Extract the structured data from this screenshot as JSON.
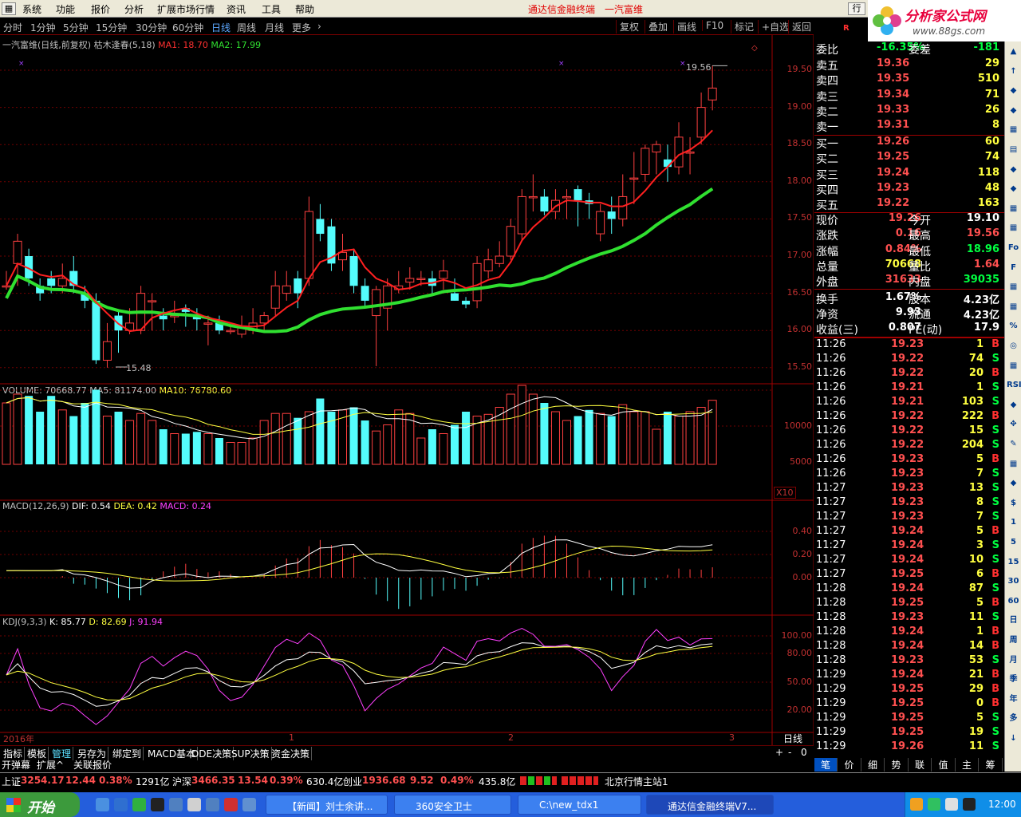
{
  "menu": {
    "items": [
      "系统",
      "功能",
      "报价",
      "分析",
      "扩展市场行情",
      "资讯",
      "工具",
      "帮助"
    ],
    "title1": "通达信金融终端",
    "title2": "一汽富维",
    "hang": "行"
  },
  "logo": {
    "text": "分析家公式网",
    "url": "www.88gs.com"
  },
  "periods": {
    "items": [
      "分时",
      "1分钟",
      "5分钟",
      "15分钟",
      "30分钟",
      "60分钟",
      "日线",
      "周线",
      "月线",
      "更多"
    ],
    "active": "日线",
    "right": [
      "复权",
      "叠加",
      "画线",
      "F10",
      "标记",
      "+自选",
      "返回"
    ]
  },
  "main": {
    "title": "一汽富维(日线,前复权) 枯木逢春(5,18)",
    "ma1": "MA1: 18.70",
    "ma2": "MA2: 17.99",
    "hi_label": "19.56",
    "lo_label": "15.48",
    "axis": [
      "19.50",
      "19.00",
      "18.50",
      "18.00",
      "17.50",
      "17.00",
      "16.50",
      "16.00",
      "15.50"
    ]
  },
  "volume": {
    "label": "VOLUME: 70668.77",
    "ma5": "MA5: 81174.00",
    "ma10": "MA10: 76780.60",
    "axis": [
      "10000",
      "5000"
    ],
    "unit": "X10"
  },
  "macd": {
    "label": "MACD(12,26,9)",
    "dif": "DIF: 0.54",
    "dea": "DEA: 0.42",
    "macd": "MACD: 0.24",
    "axis": [
      "0.40",
      "0.20",
      "0.00"
    ]
  },
  "kdj": {
    "label": "KDJ(9,3,3)",
    "k": "K: 85.77",
    "d": "D: 82.69",
    "j": "J: 91.94",
    "axis": [
      "100.00",
      "80.00",
      "50.00",
      "20.00"
    ]
  },
  "dates": {
    "year": "2016年",
    "m1": "1",
    "m2": "2",
    "m3": "3",
    "period": "日线"
  },
  "quote": {
    "wb_label": "委比",
    "wb_val": "-16.35%",
    "wc_label": "委差",
    "wc_val": "-181",
    "sells": [
      {
        "l": "卖五",
        "p": "19.36",
        "v": "29"
      },
      {
        "l": "卖四",
        "p": "19.35",
        "v": "510"
      },
      {
        "l": "卖三",
        "p": "19.34",
        "v": "71"
      },
      {
        "l": "卖二",
        "p": "19.33",
        "v": "26"
      },
      {
        "l": "卖一",
        "p": "19.31",
        "v": "8"
      }
    ],
    "buys": [
      {
        "l": "买一",
        "p": "19.26",
        "v": "60"
      },
      {
        "l": "买二",
        "p": "19.25",
        "v": "74"
      },
      {
        "l": "买三",
        "p": "19.24",
        "v": "118"
      },
      {
        "l": "买四",
        "p": "19.23",
        "v": "48"
      },
      {
        "l": "买五",
        "p": "19.22",
        "v": "163"
      }
    ],
    "stats": [
      {
        "a": "现价",
        "av": "19.26",
        "ac": "#ff5050",
        "b": "今开",
        "bv": "19.10",
        "bc": "#ffffff"
      },
      {
        "a": "涨跌",
        "av": "0.16",
        "ac": "#ff5050",
        "b": "最高",
        "bv": "19.56",
        "bc": "#ff5050"
      },
      {
        "a": "涨幅",
        "av": "0.84%",
        "ac": "#ff5050",
        "b": "最低",
        "bv": "18.96",
        "bc": "#00ff40"
      },
      {
        "a": "总量",
        "av": "70668",
        "ac": "#ffff40",
        "b": "量比",
        "bv": "1.64",
        "bc": "#ff5050"
      },
      {
        "a": "外盘",
        "av": "31633",
        "ac": "#ff5050",
        "b": "内盘",
        "bv": "39035",
        "bc": "#00ff40"
      },
      {
        "a": "换手",
        "av": "1.67%",
        "ac": "#ffffff",
        "b": "股本",
        "bv": "4.23亿",
        "bc": "#ffffff"
      },
      {
        "a": "净资",
        "av": "9.93",
        "ac": "#ffffff",
        "b": "流通",
        "bv": "4.23亿",
        "bc": "#ffffff"
      },
      {
        "a": "收益(三)",
        "av": "0.807",
        "ac": "#ffffff",
        "b": "PE(动)",
        "bv": "17.9",
        "bc": "#ffffff"
      }
    ]
  },
  "ticks": [
    [
      "11:26",
      "19.23",
      "1",
      "B"
    ],
    [
      "11:26",
      "19.22",
      "74",
      "S"
    ],
    [
      "11:26",
      "19.22",
      "20",
      "B"
    ],
    [
      "11:26",
      "19.21",
      "1",
      "S"
    ],
    [
      "11:26",
      "19.21",
      "103",
      "S"
    ],
    [
      "11:26",
      "19.22",
      "222",
      "B"
    ],
    [
      "11:26",
      "19.22",
      "15",
      "S"
    ],
    [
      "11:26",
      "19.22",
      "204",
      "S"
    ],
    [
      "11:26",
      "19.23",
      "5",
      "B"
    ],
    [
      "11:26",
      "19.23",
      "7",
      "S"
    ],
    [
      "11:27",
      "19.23",
      "13",
      "S"
    ],
    [
      "11:27",
      "19.23",
      "8",
      "S"
    ],
    [
      "11:27",
      "19.23",
      "7",
      "S"
    ],
    [
      "11:27",
      "19.24",
      "5",
      "B"
    ],
    [
      "11:27",
      "19.24",
      "3",
      "S"
    ],
    [
      "11:27",
      "19.24",
      "10",
      "S"
    ],
    [
      "11:27",
      "19.25",
      "6",
      "B"
    ],
    [
      "11:28",
      "19.24",
      "87",
      "S"
    ],
    [
      "11:28",
      "19.25",
      "5",
      "B"
    ],
    [
      "11:28",
      "19.23",
      "11",
      "S"
    ],
    [
      "11:28",
      "19.24",
      "1",
      "B"
    ],
    [
      "11:28",
      "19.24",
      "14",
      "B"
    ],
    [
      "11:28",
      "19.23",
      "53",
      "S"
    ],
    [
      "11:29",
      "19.24",
      "21",
      "B"
    ],
    [
      "11:29",
      "19.25",
      "29",
      "B"
    ],
    [
      "11:29",
      "19.25",
      "0",
      "B"
    ],
    [
      "11:29",
      "19.25",
      "5",
      "S"
    ],
    [
      "11:29",
      "19.25",
      "19",
      "S"
    ],
    [
      "11:29",
      "19.26",
      "11",
      "S"
    ]
  ],
  "sidebar": [
    "▲",
    "↑",
    "◆",
    "◆",
    "▦",
    "▤",
    "◆",
    "◆",
    "▦",
    "▦",
    "Fo",
    "F",
    "▦",
    "▦",
    "%",
    "◎",
    "▦",
    "RSI",
    "◆",
    "✥",
    "✎",
    "▦",
    "◆",
    "$",
    "1",
    "5",
    "15",
    "30",
    "60",
    "日",
    "周",
    "月",
    "季",
    "年",
    "多",
    "↓"
  ],
  "bottom": {
    "tabs": [
      "指标",
      "模板",
      "管理",
      "另存为",
      "绑定到",
      "MACD基本",
      "DDE决策",
      "SUP决策",
      "资金决策"
    ],
    "active": "管理",
    "row2": [
      "开弹幕",
      "扩展^",
      "关联报价"
    ],
    "zoom": [
      "+",
      "-",
      "0"
    ]
  },
  "rtabs": [
    "笔",
    "价",
    "细",
    "势",
    "联",
    "值",
    "主",
    "筹"
  ],
  "status": {
    "sh_l": "上证",
    "sh_v": "3254.17",
    "sh_c": "12.44",
    "sh_p": "0.38%",
    "sh_a": "1291亿",
    "sz_l": "沪深",
    "sz_v": "3466.35",
    "sz_c": "13.54",
    "sz_p": "0.39%",
    "sz_a": "630.4亿",
    "cy_l": "创业",
    "cy_v": "1936.68",
    "cy_c": "9.52",
    "cy_p": "0.49%",
    "cy_a": "435.8亿",
    "server": "北京行情主站1"
  },
  "taskbar": {
    "start": "开始",
    "tasks": [
      "【新闻】刘士余讲...",
      "360安全卫士",
      "C:\\new_tdx1",
      "通达信金融终端V7..."
    ],
    "clock": "12:00"
  },
  "colors": {
    "up": "#ff5050",
    "down": "#54fcfc",
    "ma1": "#ff2020",
    "ma2": "#30e030",
    "grid": "#800000"
  }
}
